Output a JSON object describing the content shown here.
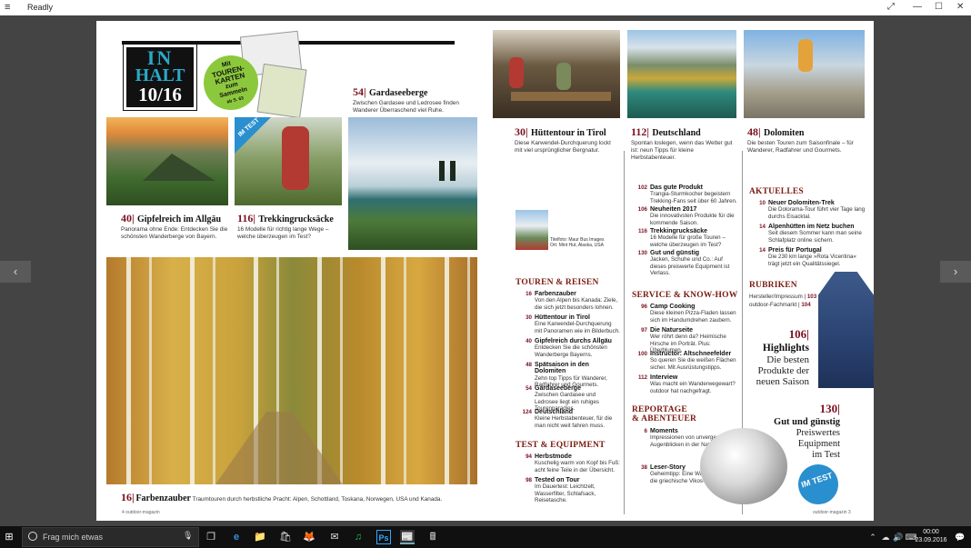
{
  "window": {
    "title": "Readly",
    "menu_glyph": "≡",
    "fullscreen_glyph": "⤢",
    "min_glyph": "—",
    "max_glyph": "☐",
    "close_glyph": "✕"
  },
  "viewer": {
    "prev_glyph": "‹",
    "next_glyph": "›"
  },
  "left": {
    "logo": {
      "l1": "IN",
      "l2": "HALT",
      "l3": "10/16"
    },
    "karten": {
      "t1": "Mit",
      "t2": "TOUREN-",
      "t3": "KARTEN",
      "t4": "zum",
      "t5": "Sammeln",
      "t6": "ab S. 63"
    },
    "im_test_badge": "IM TEST",
    "gardasee": {
      "num": "54",
      "title": "Gardaseeberge",
      "text": "Zwischen Gardasee und Ledrosee finden Wanderer Überraschend viel Ruhe."
    },
    "allgaeu": {
      "num": "40",
      "title": "Gipfelreich im Allgäu",
      "text": "Panorama ohne Ende: Entdecken Sie die schönsten Wanderberge von Bayern."
    },
    "trekking": {
      "num": "116",
      "title": "Trekkingrucksäcke",
      "text": "16 Modelle für richtig lange Wege – welche überzeugen im Test?"
    },
    "farbenzauber": {
      "num": "16",
      "title": "Farbenzauber",
      "text": "Traumtouren durch herbstliche Pracht: Alpen, Schottland, Toskana, Norwegen, USA und Kanada."
    },
    "footer": "4 outdoor-magazin"
  },
  "right": {
    "tirol": {
      "num": "30",
      "title": "Hüttentour in Tirol",
      "text": "Diese Karwendel-Durchquerung lockt mit viel ursprünglicher Bergnatur."
    },
    "deutschland": {
      "num": "112",
      "title": "Deutschland",
      "text": "Spontan loslegen, wenn das Wetter gut ist: neun Tipps für kleine Herbstabenteuer."
    },
    "dolomiten": {
      "num": "48",
      "title": "Dolomiten",
      "text": "Die besten Touren zum Saisonfinale – für Wanderer, Radfahrer und Gourmets."
    },
    "titelfoto": {
      "l1": "Titelfoto: Maur Bus Images",
      "l2": "Ort: Mint Hut, Alaska, USA"
    },
    "sections": {
      "touren": "TOUREN & REISEN",
      "test": "TEST & EQUIPMENT",
      "service": "SERVICE & KNOW-HOW",
      "reportage1": "REPORTAGE",
      "reportage2": "& ABENTEUER",
      "aktuelles": "AKTUELLES",
      "rubriken": "RUBRIKEN"
    },
    "touren": [
      {
        "pg": "16",
        "title": "Farbenzauber",
        "text": "Von den Alpen bis Kanada: Ziele, die sich jetzt besonders lohnen."
      },
      {
        "pg": "30",
        "title": "Hüttentour in Tirol",
        "text": "Eine Karwendel-Durchquerung mit Panoramen wie im Bilderbuch."
      },
      {
        "pg": "40",
        "title": "Gipfelreich durchs Allgäu",
        "text": "Entdecken Sie die schönsten Wanderberge Bayerns."
      },
      {
        "pg": "48",
        "title": "Spätsaison in den Dolomiten",
        "text": "Zehn top Tipps für Wanderer, Radfahrer und Gourmets."
      },
      {
        "pg": "54",
        "title": "Gardaseeberge",
        "text": "Zwischen Gardasee und Ledrosee liegt ein ruhiges Tourenparadies."
      },
      {
        "pg": "124",
        "title": "Deutschland",
        "text": "Kleine Herbstabenteuer, für die man nicht weit fahren muss."
      }
    ],
    "test": [
      {
        "pg": "94",
        "title": "Herbstmode",
        "text": "Kuschelig warm von Kopf bis Fuß: acht feine Teile in der Übersicht."
      },
      {
        "pg": "98",
        "title": "Tested on Tour",
        "text": "Im Dauertest: Leichtzelt, Wasserfilter, Schlafsack, Reisetasche."
      }
    ],
    "equip": [
      {
        "pg": "102",
        "title": "Das gute Produkt",
        "text": "Trangia-Sturmkocher begeistern Trekking-Fans seit über 60 Jahren."
      },
      {
        "pg": "106",
        "title": "Neuheiten 2017",
        "text": "Die innovativsten Produkte für die kommende Saison."
      },
      {
        "pg": "116",
        "title": "Trekkingrucksäcke",
        "text": "16 Modelle für große Touren – welche überzeugen im Test?"
      },
      {
        "pg": "130",
        "title": "Gut und günstig",
        "text": "Jacken, Schuhe und Co.: Auf dieses preiswerte Equipment ist Verlass."
      }
    ],
    "service": [
      {
        "pg": "96",
        "title": "Camp Cooking",
        "text": "Diese kleinen Pizza-Fladen lassen sich im Handumdrehen zaubern."
      },
      {
        "pg": "97",
        "title": "Die Naturseite",
        "text": "Wer röhrt denn da? Heimische Hirsche im Porträt. Plus: Überblumen."
      },
      {
        "pg": "100",
        "title": "Instructor: Altschneefelder",
        "text": "So queren Sie die weißen Flächen sicher. Mit Ausrüstungstipps."
      },
      {
        "pg": "112",
        "title": "Interview",
        "text": "Was macht ein Wanderwegewart? outdoor hat nachgefragt."
      }
    ],
    "reportage": [
      {
        "pg": "6",
        "title": "Moments",
        "text": "Impressionen von unvergesslichen Augenblicken in der Natur."
      },
      {
        "pg": "38",
        "title": "Leser-Story",
        "text": "Geheimtipp: Eine Wanderung durch die griechische Vikos-Schlucht."
      }
    ],
    "aktuelles": [
      {
        "pg": "10",
        "title": "Neuer Dolomiten-Trek",
        "text": "Die Dolorama-Tour führt vier Tage lang durchs Eisacktal."
      },
      {
        "pg": "14",
        "title": "Alpenhütten im Netz buchen",
        "text": "Seit diesem Sommer kann man seine Schlafplatz online sichern."
      },
      {
        "pg": "14",
        "title": "Preis für Portugal",
        "text": "Die 230 km lange »Rota Vicentina« trägt jetzt ein Qualitätssiegel."
      }
    ],
    "rubriken": [
      {
        "label": "Hersteller/Impressum",
        "pg": "103"
      },
      {
        "label": "outdoor-Fachmarkt",
        "pg": "104"
      }
    ],
    "highlights": {
      "num": "106",
      "title": "Highlights",
      "t1": "Die besten",
      "t2": "Produkte der",
      "t3": "neuen Saison"
    },
    "gut": {
      "num": "130",
      "title": "Gut und günstig",
      "t1": "Preiswertes",
      "t2": "Equipment",
      "t3": "im Test"
    },
    "im_test2": "IM TEST",
    "footer": "outdoor-magazin 3"
  },
  "taskbar": {
    "start_glyph": "⊞",
    "search_placeholder": "Frag mich etwas",
    "mic_glyph": "🎙",
    "task_view_glyph": "❐",
    "apps": [
      "e",
      "📁",
      "🛍",
      "🦊",
      "✉",
      "♫",
      "Ps",
      "📰",
      "🖩"
    ],
    "tray": {
      "up": "⌃",
      "net": "☁",
      "vol": "🔊",
      "lang": "⌨",
      "time": "00:00",
      "date": "23.09.2016",
      "notif": "💬"
    }
  },
  "colors": {
    "accent": "#7a1020",
    "section": "#7a1a10",
    "badge_green": "#8cc83c",
    "badge_blue": "#2a8fce"
  }
}
